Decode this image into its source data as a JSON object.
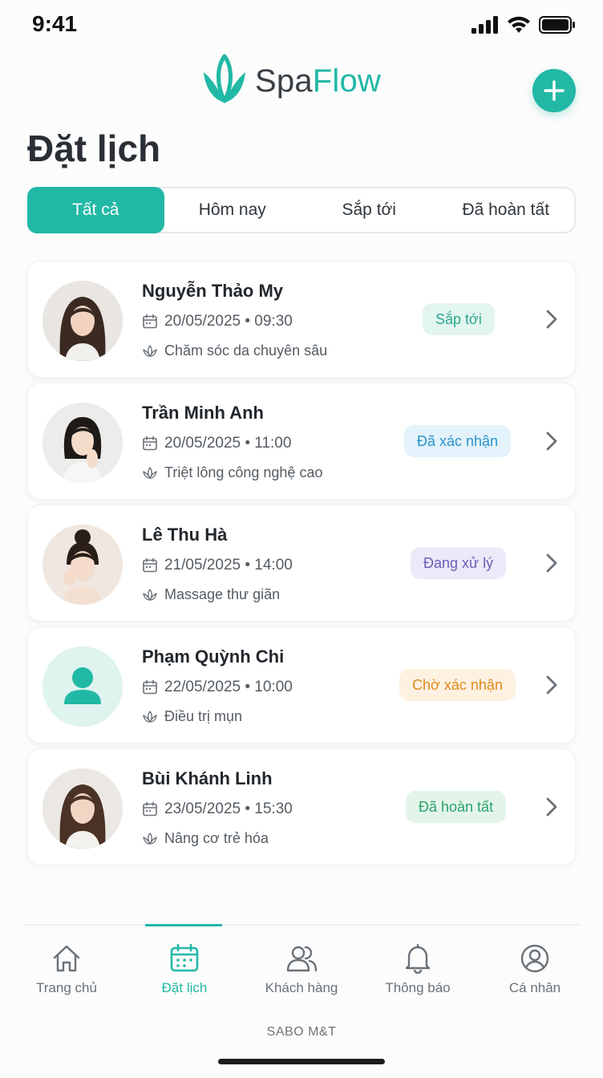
{
  "status_bar": {
    "time": "9:41"
  },
  "app": {
    "logo_part1": "Spa",
    "logo_part2": "Flow"
  },
  "header": {
    "title": "Đặt lịch"
  },
  "tabs": [
    {
      "label": "Tất cả",
      "active": true
    },
    {
      "label": "Hôm nay",
      "active": false
    },
    {
      "label": "Sắp tới",
      "active": false
    },
    {
      "label": "Đã hoàn tất",
      "active": false
    }
  ],
  "bookings": [
    {
      "name": "Nguyễn Thảo My",
      "datetime": "20/05/2025 • 09:30",
      "service": "Chăm sóc da chuyên sâu",
      "status": "Sắp tới",
      "status_color": "#2aa98f",
      "status_bg": "#e3f5ef",
      "avatar": "photo"
    },
    {
      "name": "Trần Minh Anh",
      "datetime": "20/05/2025 • 11:00",
      "service": "Triệt lông công nghệ cao",
      "status": "Đã xác nhận",
      "status_color": "#2a95c9",
      "status_bg": "#e3f2fb",
      "avatar": "photo"
    },
    {
      "name": "Lê Thu Hà",
      "datetime": "21/05/2025 • 14:00",
      "service": "Massage thư giãn",
      "status": "Đang xử lý",
      "status_color": "#6f5bb8",
      "status_bg": "#ece9f8",
      "avatar": "photo"
    },
    {
      "name": "Phạm Quỳnh Chi",
      "datetime": "22/05/2025 • 10:00",
      "service": "Điều trị mụn",
      "status": "Chờ xác nhận",
      "status_color": "#e08a1c",
      "status_bg": "#fdf1e2",
      "avatar": "placeholder"
    },
    {
      "name": "Bùi Khánh Linh",
      "datetime": "23/05/2025 • 15:30",
      "service": "Nâng cơ trẻ hóa",
      "status": "Đã hoàn tất",
      "status_color": "#2ea26a",
      "status_bg": "#e3f5ea",
      "avatar": "photo"
    }
  ],
  "bottom_nav": [
    {
      "label": "Trang chủ",
      "icon": "home-icon",
      "active": false
    },
    {
      "label": "Đặt lịch",
      "icon": "calendar-icon",
      "active": true
    },
    {
      "label": "Khách hàng",
      "icon": "customers-icon",
      "active": false
    },
    {
      "label": "Thông báo",
      "icon": "bell-icon",
      "active": false
    },
    {
      "label": "Cá nhân",
      "icon": "profile-icon",
      "active": false
    }
  ],
  "footer": {
    "brand": "SABO M&T"
  },
  "colors": {
    "accent": "#22b8a6"
  }
}
